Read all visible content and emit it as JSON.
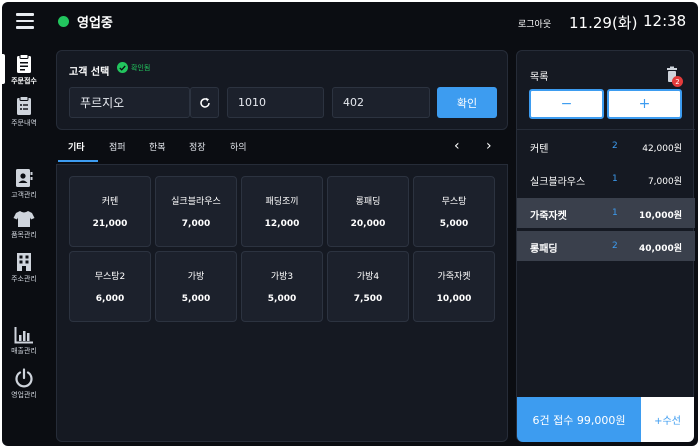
{
  "header": {
    "status": "영업중",
    "logout_label": "로그아웃",
    "date": "11.29(화)",
    "time": "12:38"
  },
  "sidebar": {
    "items": [
      {
        "label": "주문접수",
        "icon": "clipboard-icon"
      },
      {
        "label": "주문내역",
        "icon": "clipboard-list-icon"
      },
      {
        "label": "고객관리",
        "icon": "contact-card-icon"
      },
      {
        "label": "품목관리",
        "icon": "shirt-icon"
      },
      {
        "label": "주소관리",
        "icon": "building-icon"
      },
      {
        "label": "매출관리",
        "icon": "bar-chart-icon"
      },
      {
        "label": "영업관리",
        "icon": "power-icon"
      }
    ]
  },
  "customer": {
    "title": "고객 선택",
    "verified_label": "확인됨",
    "name": "푸르지오",
    "phone": "1010",
    "unit": "402",
    "confirm_label": "확인"
  },
  "tabs": [
    "기타",
    "점퍼",
    "한복",
    "정장",
    "하의"
  ],
  "products": [
    {
      "name": "커텐",
      "price": "21,000"
    },
    {
      "name": "실크블라우스",
      "price": "7,000"
    },
    {
      "name": "패딩조끼",
      "price": "12,000"
    },
    {
      "name": "롱패딩",
      "price": "20,000"
    },
    {
      "name": "무스탕",
      "price": "5,000"
    },
    {
      "name": "무스탕2",
      "price": "6,000"
    },
    {
      "name": "가방",
      "price": "5,000"
    },
    {
      "name": "가방3",
      "price": "5,000"
    },
    {
      "name": "가방4",
      "price": "7,500"
    },
    {
      "name": "가죽자켓",
      "price": "10,000"
    }
  ],
  "order": {
    "title": "목록",
    "trash_badge": "2",
    "minus_label": "−",
    "plus_label": "+",
    "rows": [
      {
        "name": "커텐",
        "qty": "2",
        "amount": "42,000원"
      },
      {
        "name": "실크블라우스",
        "qty": "1",
        "amount": "7,000원"
      },
      {
        "name": "가죽자켓",
        "qty": "1",
        "amount": "10,000원"
      },
      {
        "name": "롱패딩",
        "qty": "2",
        "amount": "40,000원"
      }
    ],
    "total_label": "6건 접수 99,000원",
    "repair_label": "+수선"
  },
  "colors": {
    "accent": "#3d9cf0",
    "status_green": "#22c55e",
    "badge_red": "#e23b3b"
  }
}
